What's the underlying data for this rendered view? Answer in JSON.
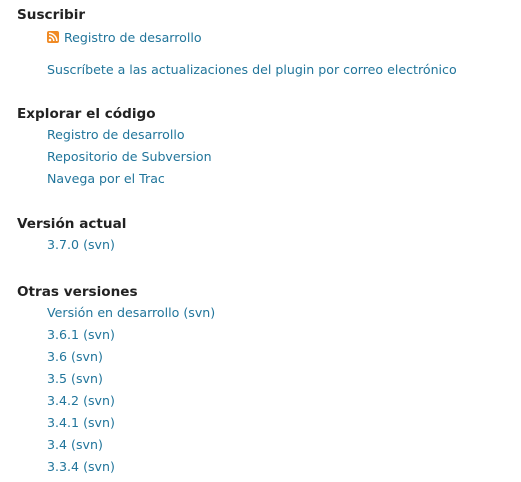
{
  "subscribe": {
    "title": "Suscribir",
    "dev_log_label": "Registro de desarrollo",
    "email_label": "Suscríbete a las actualizaciones del plugin por correo electrónico",
    "icon": "rss-icon"
  },
  "browse": {
    "title": "Explorar el código",
    "items": [
      {
        "label": "Registro de desarrollo"
      },
      {
        "label": "Repositorio de Subversion"
      },
      {
        "label": "Navega por el Trac"
      }
    ]
  },
  "current": {
    "title": "Versión actual",
    "version": "3.7.0",
    "suffix": "(svn)"
  },
  "other": {
    "title": "Otras versiones",
    "items": [
      {
        "label": "Versión en desarrollo",
        "suffix": "(svn)"
      },
      {
        "label": "3.6.1",
        "suffix": "(svn)"
      },
      {
        "label": "3.6",
        "suffix": "(svn)"
      },
      {
        "label": "3.5",
        "suffix": "(svn)"
      },
      {
        "label": "3.4.2",
        "suffix": "(svn)"
      },
      {
        "label": "3.4.1",
        "suffix": "(svn)"
      },
      {
        "label": "3.4",
        "suffix": "(svn)"
      },
      {
        "label": "3.3.4",
        "suffix": "(svn)"
      }
    ]
  },
  "colors": {
    "link": "#21759b",
    "heading": "#222222",
    "rss": "#f08a24"
  }
}
